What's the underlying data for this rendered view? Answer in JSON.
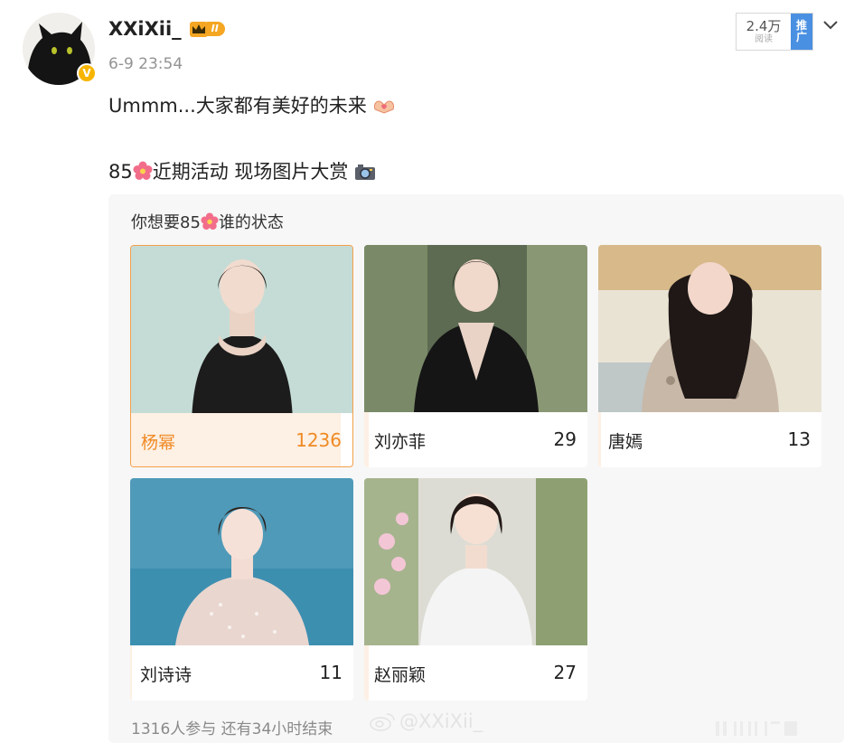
{
  "user": {
    "name": "XXiXii_",
    "vip_level": "II",
    "timestamp": "6-9 23:54",
    "verified_badge": "V"
  },
  "stats": {
    "read_count": "2.4万",
    "read_label": "阅读",
    "promo_line1": "推",
    "promo_line2": "广"
  },
  "post": {
    "line1": "Ummm...大家都有美好的未来",
    "line2_prefix": "85",
    "line2_text": "近期活动  现场图片大赏"
  },
  "poll": {
    "question_prefix": "你想要85",
    "question_suffix": "谁的状态",
    "options": [
      {
        "name": "杨幂",
        "votes": "1236",
        "share": 0.94,
        "selected": true
      },
      {
        "name": "刘亦菲",
        "votes": "29",
        "share": 0.02,
        "selected": false
      },
      {
        "name": "唐嫣",
        "votes": "13",
        "share": 0.01,
        "selected": false
      },
      {
        "name": "刘诗诗",
        "votes": "11",
        "share": 0.01,
        "selected": false
      },
      {
        "name": "赵丽颖",
        "votes": "27",
        "share": 0.02,
        "selected": false
      }
    ],
    "footer": "1316人参与 还有34小时结束"
  },
  "watermark": {
    "handle": "@XXiXii_"
  },
  "colors": {
    "selected": "#f08a24",
    "selected_bar": "#fdf0e4",
    "promo": "#4a90e2",
    "card_bg": "#f7f7f7"
  },
  "icons": [
    "cat-avatar",
    "verified-badge-icon",
    "vip-crown-icon",
    "chevron-down-icon",
    "heart-hands-emoji",
    "cherry-blossom-emoji",
    "camera-emoji",
    "weibo-logo-icon"
  ]
}
